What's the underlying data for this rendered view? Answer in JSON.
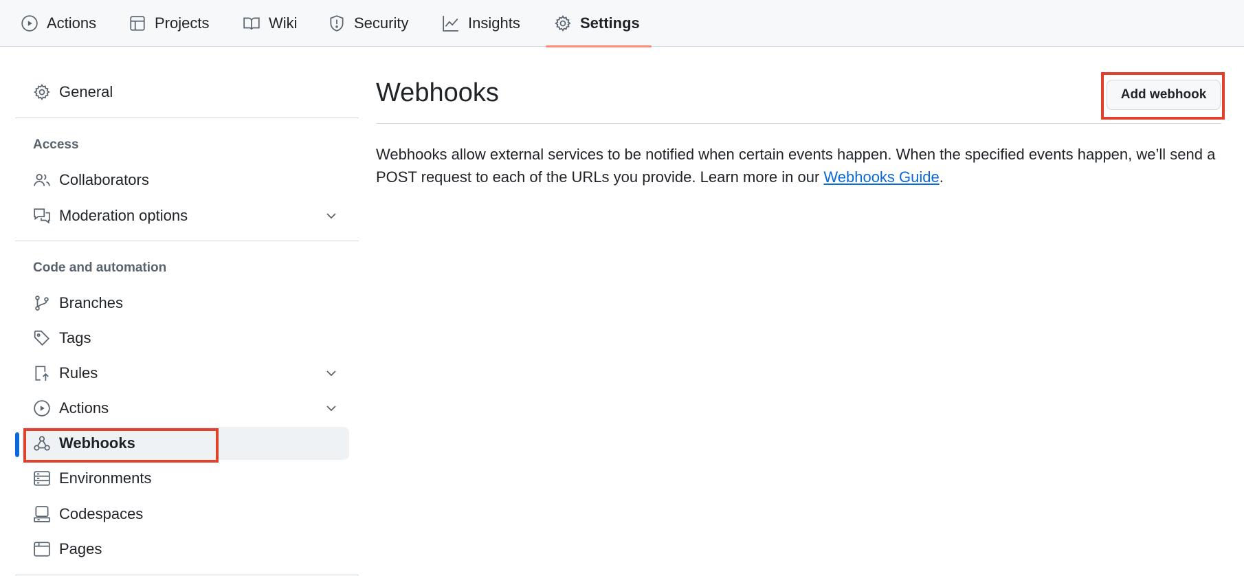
{
  "topnav": {
    "tabs": [
      {
        "label": "Actions",
        "icon": "play-circle-icon"
      },
      {
        "label": "Projects",
        "icon": "table-icon"
      },
      {
        "label": "Wiki",
        "icon": "book-icon"
      },
      {
        "label": "Security",
        "icon": "shield-icon"
      },
      {
        "label": "Insights",
        "icon": "graph-icon"
      },
      {
        "label": "Settings",
        "icon": "gear-icon",
        "active": true
      }
    ]
  },
  "sidebar": {
    "general": "General",
    "access_heading": "Access",
    "collaborators": "Collaborators",
    "moderation": "Moderation options",
    "code_heading": "Code and automation",
    "branches": "Branches",
    "tags": "Tags",
    "rules": "Rules",
    "actions": "Actions",
    "webhooks": "Webhooks",
    "environments": "Environments",
    "codespaces": "Codespaces",
    "pages": "Pages"
  },
  "main": {
    "title": "Webhooks",
    "add_button": "Add webhook",
    "description_pre": "Webhooks allow external services to be notified when certain events happen. When the specified events happen, we’ll send a POST request to each of the URLs you provide. Learn more in our ",
    "guide_link": "Webhooks Guide",
    "description_post": "."
  },
  "colors": {
    "accent_link": "#0969da",
    "active_tab_underline": "#fd8c73",
    "highlight_box": "#e0412c"
  }
}
